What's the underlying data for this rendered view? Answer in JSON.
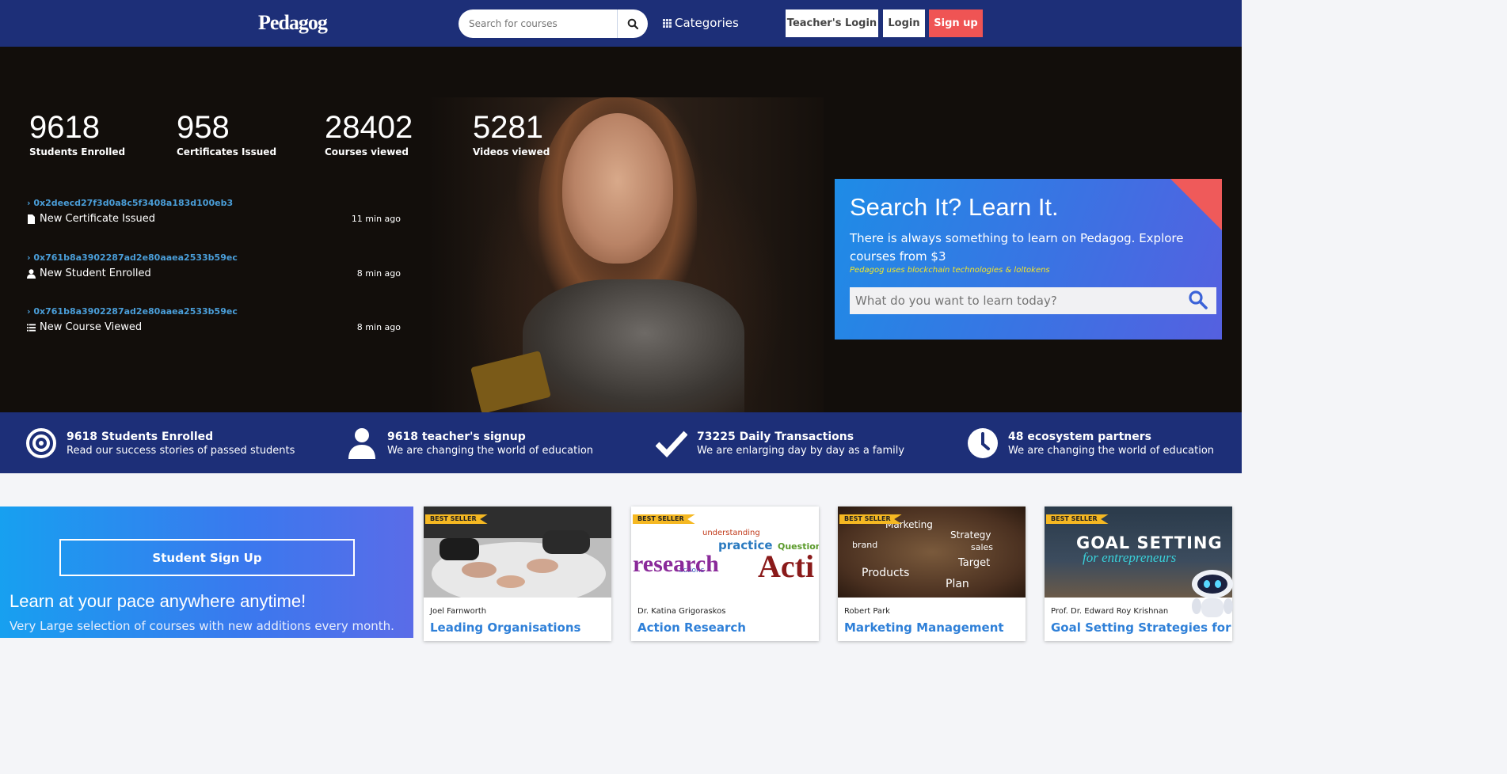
{
  "nav": {
    "logo": "Pedagog",
    "search_placeholder": "Search for courses",
    "categories": "Categories",
    "teacher_login": "Teacher's Login",
    "login": "Login",
    "signup": "Sign up"
  },
  "hero": {
    "stats": [
      {
        "num": "9618",
        "label": "Students Enrolled"
      },
      {
        "num": "958",
        "label": "Certificates Issued"
      },
      {
        "num": "28402",
        "label": "Courses viewed"
      },
      {
        "num": "5281",
        "label": "Videos viewed"
      }
    ],
    "feed": [
      {
        "hash": "0x2deecd27f3d0a8c5f3408a183d100eb3",
        "event": "New Certificate Issued",
        "time": "11 min ago",
        "icon": "file-icon"
      },
      {
        "hash": "0x761b8a3902287ad2e80aaea2533b59ec",
        "event": "New Student Enrolled",
        "time": "8 min ago",
        "icon": "user-icon"
      },
      {
        "hash": "0x761b8a3902287ad2e80aaea2533b59ec",
        "event": "New Course Viewed",
        "time": "8 min ago",
        "icon": "list-icon"
      }
    ],
    "promo": {
      "title": "Search It? Learn It.",
      "description": "There is always something to learn on Pedagog. Explore courses from $3",
      "tagline": "Pedagog uses blockchain technologies & loltokens",
      "search_placeholder": "What do you want to learn today?"
    }
  },
  "features": [
    {
      "title": "9618 Students Enrolled",
      "subtitle": "Read our success stories of passed students",
      "icon": "target-icon"
    },
    {
      "title": "9618 teacher's signup",
      "subtitle": "We are changing the world of education",
      "icon": "user-icon"
    },
    {
      "title": "73225 Daily Transactions",
      "subtitle": "We are enlarging day by day as a family",
      "icon": "check-icon"
    },
    {
      "title": "48 ecosystem partners",
      "subtitle": "We are changing the world of education",
      "icon": "clock-icon"
    }
  ],
  "signup_panel": {
    "button": "Student Sign Up",
    "heading": "Learn at your pace anywhere anytime!",
    "text": "Very Large selection of courses with new additions every month."
  },
  "courses": [
    {
      "badge": "BEST SELLER",
      "author": "Joel Farnworth",
      "title": "Leading Organisations"
    },
    {
      "badge": "BEST SELLER",
      "author": "Dr. Katina Grigoraskos",
      "title": "Action Research",
      "image_words": [
        "research",
        "Acti",
        "practice",
        "Question",
        "actions",
        "understanding"
      ]
    },
    {
      "badge": "BEST SELLER",
      "author": "Robert Park",
      "title": "Marketing Management",
      "image_words": [
        "Marketing",
        "Strategy",
        "sales",
        "brand",
        "Target",
        "Products",
        "Plan"
      ]
    },
    {
      "badge": "BEST SELLER",
      "author": "Prof. Dr. Edward Roy Krishnan",
      "title": "Goal Setting Strategies for",
      "image_words": [
        "GOAL SETTING",
        "for entrepreneurs"
      ]
    }
  ],
  "colors": {
    "navy": "#1d2f78",
    "signup_red": "#ef5454",
    "link_blue": "#2f80d8",
    "hash_blue": "#4a9ed9",
    "badge_yellow": "#f5b822"
  }
}
